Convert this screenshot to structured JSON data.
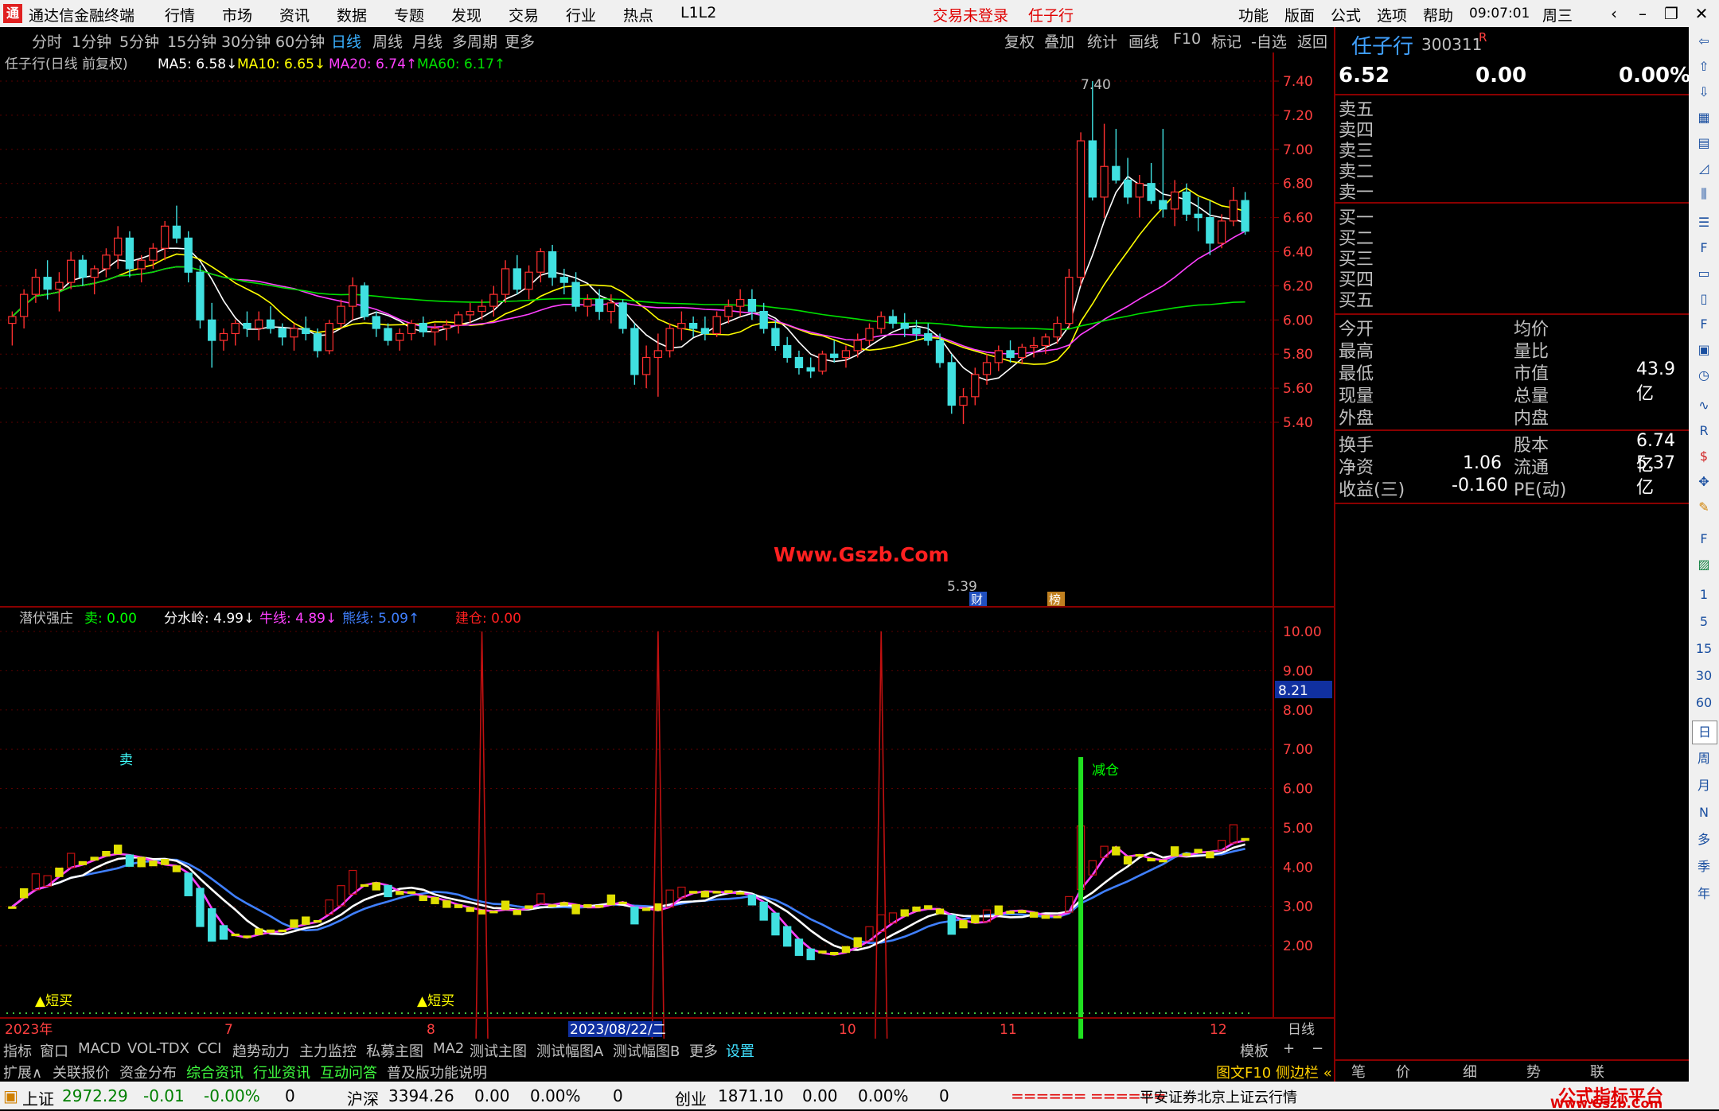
{
  "titlebar": {
    "app_title": "通达信金融终端",
    "menus": [
      "行情",
      "市场",
      "资讯",
      "数据",
      "专题",
      "发现",
      "交易",
      "行业",
      "热点",
      "L1L2"
    ],
    "trade_status": "交易未登录",
    "stock_name": "任子行",
    "right_menus": [
      "功能",
      "版面",
      "公式",
      "选项",
      "帮助"
    ],
    "time": "09:07:01",
    "weekday": "周三"
  },
  "periods": {
    "items": [
      "分时",
      "1分钟",
      "5分钟",
      "15分钟",
      "30分钟",
      "60分钟",
      "日线",
      "周线",
      "月线",
      "多周期",
      "更多"
    ],
    "active": "日线",
    "right_buttons": [
      "复权",
      "叠加",
      "统计",
      "画线",
      "F10",
      "标记",
      "-自选",
      "返回"
    ]
  },
  "main_chart": {
    "title": "任子行(日线 前复权)",
    "ma_labels": [
      {
        "text": "MA5: 6.58↓",
        "color": "#ffffff"
      },
      {
        "text": "MA10: 6.65↓",
        "color": "#ffff00"
      },
      {
        "text": "MA20: 6.74↑",
        "color": "#ff40ff"
      },
      {
        "text": "MA60: 6.17↑",
        "color": "#00e000"
      }
    ],
    "y_ticks": [
      "7.40",
      "7.20",
      "7.00",
      "6.80",
      "6.60",
      "6.40",
      "6.20",
      "6.00",
      "5.80",
      "5.60",
      "5.40"
    ],
    "high_label": "7.40",
    "low_label": "5.39",
    "watermark": "Www.Gszb.Com",
    "markers": [
      "财",
      "榜"
    ]
  },
  "indicator": {
    "title": "潜伏强庄",
    "labels": [
      {
        "text": "卖: 0.00",
        "color": "#00ff00"
      },
      {
        "text": "分水岭: 4.99↓",
        "color": "#ffffff"
      },
      {
        "text": "牛线: 4.89↓",
        "color": "#ff40ff"
      },
      {
        "text": "熊线: 5.09↑",
        "color": "#4080ff"
      },
      {
        "text": "建仓: 0.00",
        "color": "#ff2020"
      }
    ],
    "y_ticks": [
      "10.00",
      "9.00",
      "8.00",
      "7.00",
      "6.00",
      "5.00",
      "4.00",
      "3.00",
      "2.00"
    ],
    "cursor_value": "8.21",
    "sell_label": "卖",
    "build_label": "减仓",
    "short_buy_label": "▲短买"
  },
  "x_axis": {
    "labels": [
      "2023年",
      "7",
      "8",
      "2023/08/22/二",
      "10",
      "11",
      "12"
    ],
    "period": "日线"
  },
  "tabs": {
    "items": [
      "指标",
      "窗口",
      "MACD",
      "VOL-TDX",
      "CCI",
      "趋势动力",
      "主力监控",
      "私募主图",
      "MA2",
      "测试主图",
      "测试幅图A",
      "测试幅图B",
      "更多",
      "设置"
    ],
    "right": [
      "模板",
      "+",
      "−"
    ]
  },
  "ext_tabs": {
    "items": [
      "扩展∧",
      "关联报价",
      "资金分布",
      "综合资讯",
      "行业资讯",
      "互动问答",
      "普及版功能说明"
    ],
    "right": "图文F10 侧边栏 «"
  },
  "quote": {
    "name": "任子行",
    "code": "300311",
    "tag": "R",
    "price": "6.52",
    "change": "0.00",
    "pct": "0.00%",
    "sell_levels": [
      "卖五",
      "卖四",
      "卖三",
      "卖二",
      "卖一"
    ],
    "buy_levels": [
      "买一",
      "买二",
      "买三",
      "买四",
      "买五"
    ],
    "stats_left": [
      "今开",
      "最高",
      "最低",
      "现量",
      "外盘"
    ],
    "stats_right": [
      "均价",
      "量比",
      "市值",
      "总量",
      "内盘"
    ],
    "market_value": "43.9亿",
    "fin_left": [
      "换手",
      "净资",
      "收益(三)"
    ],
    "fin_left_values": [
      "",
      "1.06",
      "-0.160"
    ],
    "fin_right": [
      "股本",
      "流通",
      "PE(动)"
    ],
    "fin_right_values": [
      "6.74亿",
      "5.37亿",
      ""
    ],
    "bottom_tabs": [
      "笔",
      "价",
      "细",
      "势",
      "联"
    ]
  },
  "statusbar": {
    "indices": [
      {
        "name": "上证",
        "value": "2972.29",
        "change": "-0.01",
        "pct": "-0.00%",
        "vol": "0"
      },
      {
        "name": "沪深",
        "value": "3394.26",
        "change": "0.00",
        "pct": "0.00%",
        "vol": "0"
      },
      {
        "name": "创业",
        "value": "1871.10",
        "change": "0.00",
        "pct": "0.00%",
        "vol": "0"
      }
    ],
    "broker": "平安证券北京上证云行情",
    "brand": "公式指标平台",
    "brand_url": "Www.Gszb.Com"
  },
  "chart_data": [
    {
      "type": "candlestick",
      "title": "任子行(日线 前复权)",
      "ylim": [
        5.3,
        7.5
      ],
      "high": 7.4,
      "low": 5.39,
      "candles": [
        [
          5.98,
          6.05,
          5.85,
          6.02
        ],
        [
          6.02,
          6.18,
          5.95,
          6.15
        ],
        [
          6.15,
          6.3,
          6.1,
          6.25
        ],
        [
          6.25,
          6.35,
          6.12,
          6.18
        ],
        [
          6.18,
          6.28,
          6.05,
          6.22
        ],
        [
          6.22,
          6.4,
          6.18,
          6.35
        ],
        [
          6.35,
          6.38,
          6.2,
          6.25
        ],
        [
          6.25,
          6.32,
          6.15,
          6.3
        ],
        [
          6.3,
          6.42,
          6.25,
          6.38
        ],
        [
          6.38,
          6.55,
          6.3,
          6.48
        ],
        [
          6.48,
          6.52,
          6.25,
          6.3
        ],
        [
          6.3,
          6.38,
          6.22,
          6.35
        ],
        [
          6.35,
          6.45,
          6.3,
          6.42
        ],
        [
          6.42,
          6.58,
          6.35,
          6.55
        ],
        [
          6.55,
          6.67,
          6.45,
          6.48
        ],
        [
          6.48,
          6.52,
          6.22,
          6.28
        ],
        [
          6.28,
          6.32,
          5.95,
          6.0
        ],
        [
          6.0,
          6.1,
          5.72,
          5.88
        ],
        [
          5.88,
          5.95,
          5.82,
          5.92
        ],
        [
          5.92,
          6.0,
          5.85,
          5.98
        ],
        [
          5.98,
          6.05,
          5.9,
          5.95
        ],
        [
          5.95,
          6.05,
          5.88,
          6.0
        ],
        [
          6.0,
          6.08,
          5.92,
          5.95
        ],
        [
          5.95,
          5.98,
          5.85,
          5.9
        ],
        [
          5.9,
          5.98,
          5.82,
          5.95
        ],
        [
          5.95,
          6.02,
          5.88,
          5.92
        ],
        [
          5.92,
          5.95,
          5.78,
          5.82
        ],
        [
          5.82,
          6.0,
          5.8,
          5.98
        ],
        [
          5.98,
          6.12,
          5.95,
          6.08
        ],
        [
          6.08,
          6.25,
          6.0,
          6.2
        ],
        [
          6.2,
          6.22,
          6.0,
          6.02
        ],
        [
          6.02,
          6.05,
          5.9,
          5.95
        ],
        [
          5.95,
          5.98,
          5.85,
          5.88
        ],
        [
          5.88,
          5.95,
          5.82,
          5.92
        ],
        [
          5.92,
          6.0,
          5.88,
          5.98
        ],
        [
          5.98,
          6.02,
          5.9,
          5.93
        ],
        [
          5.93,
          5.98,
          5.85,
          5.95
        ],
        [
          5.95,
          6.0,
          5.88,
          5.97
        ],
        [
          5.97,
          6.05,
          5.92,
          6.03
        ],
        [
          6.03,
          6.1,
          5.98,
          6.05
        ],
        [
          6.05,
          6.12,
          6.0,
          6.08
        ],
        [
          6.08,
          6.2,
          6.02,
          6.15
        ],
        [
          6.15,
          6.35,
          6.1,
          6.3
        ],
        [
          6.3,
          6.38,
          6.15,
          6.18
        ],
        [
          6.18,
          6.32,
          6.12,
          6.28
        ],
        [
          6.28,
          6.42,
          6.22,
          6.4
        ],
        [
          6.4,
          6.44,
          6.2,
          6.25
        ],
        [
          6.25,
          6.3,
          6.15,
          6.22
        ],
        [
          6.22,
          6.28,
          6.05,
          6.08
        ],
        [
          6.08,
          6.15,
          6.02,
          6.12
        ],
        [
          6.12,
          6.18,
          6.0,
          6.05
        ],
        [
          6.05,
          6.15,
          5.98,
          6.1
        ],
        [
          6.1,
          6.12,
          5.92,
          5.95
        ],
        [
          5.95,
          5.98,
          5.62,
          5.68
        ],
        [
          5.68,
          5.85,
          5.6,
          5.78
        ],
        [
          5.78,
          5.92,
          5.55,
          5.82
        ],
        [
          5.82,
          5.98,
          5.78,
          5.95
        ],
        [
          5.95,
          6.05,
          5.88,
          5.98
        ],
        [
          5.98,
          6.02,
          5.9,
          5.95
        ],
        [
          5.95,
          6.02,
          5.88,
          5.92
        ],
        [
          5.92,
          6.05,
          5.9,
          6.02
        ],
        [
          6.02,
          6.12,
          5.98,
          6.08
        ],
        [
          6.08,
          6.18,
          6.02,
          6.12
        ],
        [
          6.12,
          6.18,
          6.0,
          6.05
        ],
        [
          6.05,
          6.1,
          5.92,
          5.95
        ],
        [
          5.95,
          6.0,
          5.82,
          5.85
        ],
        [
          5.85,
          5.9,
          5.75,
          5.78
        ],
        [
          5.78,
          5.82,
          5.68,
          5.72
        ],
        [
          5.72,
          5.78,
          5.66,
          5.7
        ],
        [
          5.7,
          5.82,
          5.68,
          5.8
        ],
        [
          5.8,
          5.88,
          5.75,
          5.78
        ],
        [
          5.78,
          5.85,
          5.72,
          5.82
        ],
        [
          5.82,
          5.92,
          5.78,
          5.88
        ],
        [
          5.88,
          5.98,
          5.85,
          5.95
        ],
        [
          5.95,
          6.05,
          5.92,
          6.02
        ],
        [
          6.02,
          6.06,
          5.95,
          5.98
        ],
        [
          5.98,
          6.04,
          5.9,
          5.95
        ],
        [
          5.95,
          6.0,
          5.88,
          5.92
        ],
        [
          5.92,
          5.98,
          5.85,
          5.88
        ],
        [
          5.88,
          5.92,
          5.72,
          5.75
        ],
        [
          5.75,
          5.8,
          5.45,
          5.5
        ],
        [
          5.5,
          5.6,
          5.39,
          5.55
        ],
        [
          5.55,
          5.72,
          5.5,
          5.68
        ],
        [
          5.68,
          5.8,
          5.62,
          5.75
        ],
        [
          5.75,
          5.85,
          5.7,
          5.82
        ],
        [
          5.82,
          5.88,
          5.75,
          5.78
        ],
        [
          5.78,
          5.86,
          5.74,
          5.84
        ],
        [
          5.84,
          5.9,
          5.78,
          5.85
        ],
        [
          5.85,
          5.92,
          5.8,
          5.9
        ],
        [
          5.9,
          6.02,
          5.86,
          5.98
        ],
        [
          5.98,
          6.3,
          5.95,
          6.25
        ],
        [
          6.25,
          7.1,
          6.2,
          7.05
        ],
        [
          7.05,
          7.4,
          6.7,
          6.72
        ],
        [
          6.72,
          7.15,
          6.6,
          6.9
        ],
        [
          6.9,
          7.12,
          6.8,
          6.82
        ],
        [
          6.82,
          6.95,
          6.68,
          6.72
        ],
        [
          6.72,
          6.85,
          6.6,
          6.8
        ],
        [
          6.8,
          6.92,
          6.68,
          6.7
        ],
        [
          6.7,
          7.12,
          6.6,
          6.65
        ],
        [
          6.65,
          6.82,
          6.55,
          6.75
        ],
        [
          6.75,
          6.8,
          6.58,
          6.62
        ],
        [
          6.62,
          6.72,
          6.52,
          6.6
        ],
        [
          6.6,
          6.7,
          6.38,
          6.45
        ],
        [
          6.45,
          6.62,
          6.42,
          6.58
        ],
        [
          6.58,
          6.78,
          6.55,
          6.7
        ],
        [
          6.7,
          6.75,
          6.5,
          6.52
        ]
      ],
      "series": [
        {
          "name": "MA5",
          "current": 6.58,
          "color": "#ffffff"
        },
        {
          "name": "MA10",
          "current": 6.65,
          "color": "#ffff00"
        },
        {
          "name": "MA20",
          "current": 6.74,
          "color": "#ff40ff"
        },
        {
          "name": "MA60",
          "current": 6.17,
          "color": "#00e000"
        }
      ]
    },
    {
      "type": "line",
      "title": "潜伏强庄",
      "ylim": [
        1.0,
        10.5
      ],
      "series": [
        {
          "name": "分水岭",
          "current": 4.99,
          "color": "#ffffff"
        },
        {
          "name": "牛线",
          "current": 4.89,
          "color": "#ff40ff"
        },
        {
          "name": "熊线",
          "current": 5.09,
          "color": "#4080ff"
        }
      ],
      "spikes": [
        {
          "index": 40,
          "value": 10.0
        },
        {
          "index": 55,
          "value": 10.0
        },
        {
          "index": 74,
          "value": 10.0
        }
      ]
    }
  ]
}
